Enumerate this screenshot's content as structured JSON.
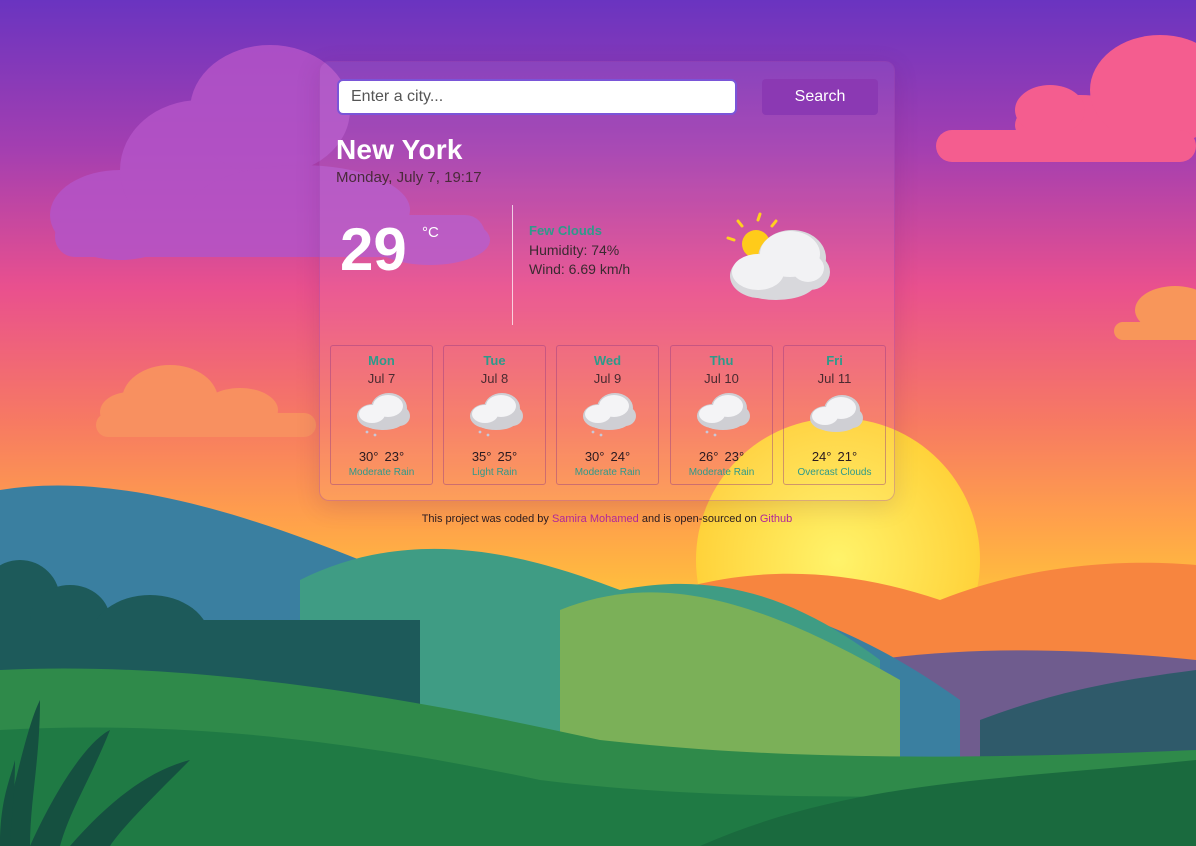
{
  "search": {
    "placeholder": "Enter a city...",
    "button_label": "Search"
  },
  "current": {
    "city": "New York",
    "date": "Monday, July 7, 19:17",
    "temperature": "29",
    "unit": "°C",
    "condition": "Few Clouds",
    "humidity": "Humidity: 74%",
    "wind": "Wind: 6.69 km/h",
    "icon": "sun-behind-cloud-icon"
  },
  "forecast": [
    {
      "day": "Mon",
      "date": "Jul 7",
      "high": "30°",
      "low": "23°",
      "description": "Moderate Rain",
      "icon": "rain-cloud-icon"
    },
    {
      "day": "Tue",
      "date": "Jul 8",
      "high": "35°",
      "low": "25°",
      "description": "Light Rain",
      "icon": "rain-cloud-icon"
    },
    {
      "day": "Wed",
      "date": "Jul 9",
      "high": "30°",
      "low": "24°",
      "description": "Moderate Rain",
      "icon": "rain-cloud-icon"
    },
    {
      "day": "Thu",
      "date": "Jul 10",
      "high": "26°",
      "low": "23°",
      "description": "Moderate Rain",
      "icon": "rain-cloud-icon"
    },
    {
      "day": "Fri",
      "date": "Jul 11",
      "high": "24°",
      "low": "21°",
      "description": "Overcast Clouds",
      "icon": "cloud-icon"
    }
  ],
  "footer": {
    "prefix": "This project was coded by",
    "author": "Samira Mohamed",
    "middle": "and is open-sourced on",
    "repo": "Github"
  },
  "colors": {
    "accent": "#8b39b3",
    "forecast_text": "#2e9a8a",
    "link": "#b0279a"
  }
}
